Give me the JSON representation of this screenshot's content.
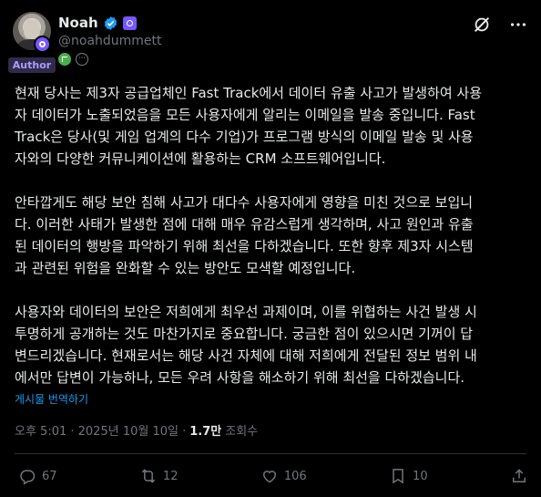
{
  "user": {
    "display_name": "Noah",
    "handle": "@noahdummett",
    "role_badge": "Author",
    "avatar_icon": "profile-avatar"
  },
  "tweet": {
    "paragraphs": [
      "현재 당사는 제3자 공급업체인 Fast Track에서 데이터 유출 사고가 발생하여 사용\n자 데이터가 노출되었음을 모든 사용자에게 알리는 이메일을 발송 중입니다. Fast\nTrack은 당사(및 게임 업계의 다수 기업)가 프로그램 방식의 이메일 발송 및 사용\n자와의 다양한 커뮤니케이션에 활용하는 CRM 소프트웨어입니다.",
      "안타깝게도 해당 보안 침해 사고가 대다수 사용자에게 영향을 미친 것으로 보입니\n다. 이러한 사태가 발생한 점에 대해 매우 유감스럽게 생각하며, 사고 원인과 유출\n된 데이터의 행방을 파악하기 위해 최선을 다하겠습니다. 또한 향후 제3자 시스템\n과 관련된 위험을 완화할 수 있는 방안도 모색할 예정입니다.",
      "사용자와 데이터의 보안은 저희에게 최우선 과제이며, 이를 위협하는 사건 발생 시\n투명하게 공개하는 것도 마찬가지로 중요합니다. 궁금한 점이 있으시면 기꺼이 답\n변드리겠습니다. 현재로서는 해당 사건 자체에 대해 저희에게 전달된 정보 범위 내\n에서만 답변이 가능하나, 모든 우려 사항을 해소하기 위해 최선을 다하겠습니다."
    ],
    "translate_label": "게시물 번역하기",
    "timestamp": "오후 5:01 · 2025년 10월 10일 ·",
    "views_count": "1.7만",
    "views_label": "조회수"
  },
  "actions": {
    "replies": "67",
    "reposts": "12",
    "likes": "106",
    "bookmarks": "10"
  },
  "colors": {
    "background": "#000000",
    "text": "#e7e9ea",
    "muted": "#71767b",
    "link": "#1d9bf0",
    "affiliate": "#7856ff"
  }
}
